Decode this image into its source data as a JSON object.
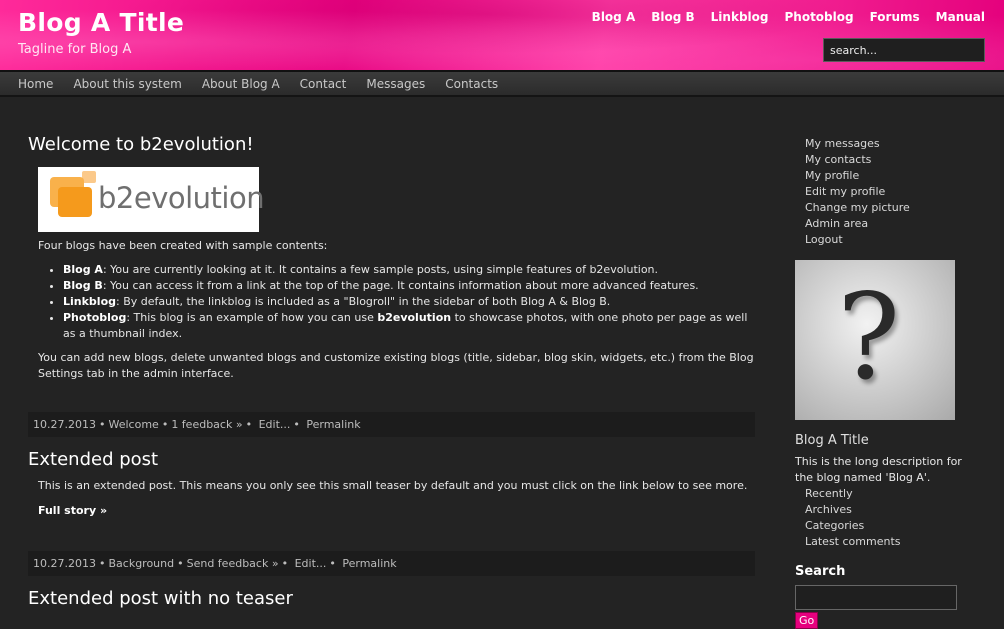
{
  "header": {
    "title": "Blog A Title",
    "tagline": "Tagline for Blog A",
    "links": [
      "Blog A",
      "Blog B",
      "Linkblog",
      "Photoblog",
      "Forums",
      "Manual"
    ],
    "search_placeholder": "search...",
    "accent_color": "#e6007e"
  },
  "nav": {
    "items": [
      "Home",
      "About this system",
      "About Blog A",
      "Contact",
      "Messages",
      "Contacts"
    ]
  },
  "posts": [
    {
      "title": "Welcome to b2evolution!",
      "logo_text": "b2evolution",
      "intro": "Four blogs have been created with sample contents:",
      "bullets": [
        {
          "name": "Blog A",
          "text": ": You are currently looking at it. It contains a few sample posts, using simple features of b2evolution."
        },
        {
          "name": "Blog B",
          "text": ": You can access it from a link at the top of the page. It contains information about more advanced features."
        },
        {
          "name": "Linkblog",
          "text": ": By default, the linkblog is included as a \"Blogroll\" in the sidebar of both Blog A & Blog B."
        },
        {
          "name": "Photoblog",
          "text_a": ": This blog is an example of how you can use ",
          "bold": "b2evolution",
          "text_b": " to showcase photos, with one photo per page as well as a thumbnail index."
        }
      ],
      "outro": "You can add new blogs, delete unwanted blogs and customize existing blogs (title, sidebar, blog skin, widgets, etc.) from the Blog Settings tab in the admin interface.",
      "meta": {
        "date": "10.27.2013",
        "category": "Welcome",
        "feedback": "1 feedback »",
        "edit": "Edit...",
        "permalink": "Permalink"
      }
    },
    {
      "title": "Extended post",
      "text": "This is an extended post. This means you only see this small teaser by default and you must click on the link below to see more.",
      "more": "Full story »",
      "meta": {
        "date": "10.27.2013",
        "category": "Background",
        "feedback": "Send feedback »",
        "edit": "Edit...",
        "permalink": "Permalink"
      }
    },
    {
      "title": "Extended post with no teaser"
    }
  ],
  "sidebar": {
    "user_links": [
      "My messages",
      "My contacts",
      "My profile",
      "Edit my profile",
      "Change my picture",
      "Admin area",
      "Logout"
    ],
    "avatar_icon": "question-mark-icon",
    "blog_title": "Blog A Title",
    "blog_desc": "This is the long description for the blog named 'Blog A'.",
    "blog_links": [
      "Recently",
      "Archives",
      "Categories",
      "Latest comments"
    ],
    "search_title": "Search",
    "go_label": "Go"
  }
}
